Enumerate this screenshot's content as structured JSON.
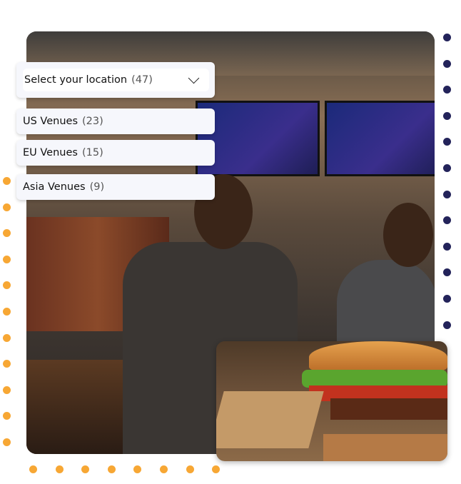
{
  "location_select": {
    "label": "Select your location",
    "count": "(47)",
    "icon": "chevron-down-icon"
  },
  "options": [
    {
      "label": "US Venues",
      "count": "(23)"
    },
    {
      "label": "EU Venues",
      "count": "(15)"
    },
    {
      "label": "Asia Venues",
      "count": "(9)"
    }
  ],
  "colors": {
    "dots_right": "#23235a",
    "dots_left": "#f7a734",
    "card_bg": "#f6f7fc"
  }
}
